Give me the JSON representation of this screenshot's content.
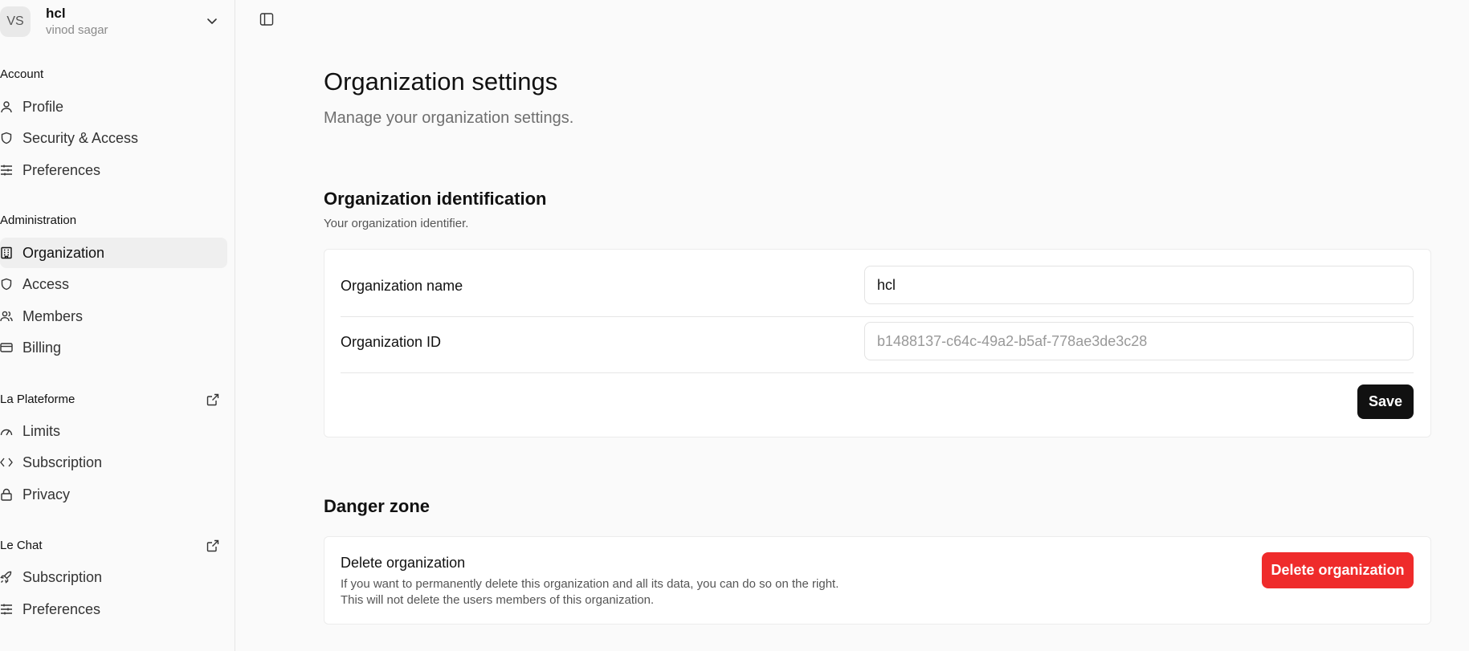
{
  "org_switcher": {
    "avatar_initials": "VS",
    "org_name": "hcl",
    "user_name": "vinod sagar"
  },
  "sidebar": {
    "sections": [
      {
        "label": "Account",
        "items": [
          {
            "label": "Profile",
            "icon": "user-icon"
          },
          {
            "label": "Security & Access",
            "icon": "shield-icon"
          },
          {
            "label": "Preferences",
            "icon": "sliders-icon"
          }
        ]
      },
      {
        "label": "Administration",
        "items": [
          {
            "label": "Organization",
            "icon": "building-icon",
            "active": true
          },
          {
            "label": "Access",
            "icon": "shield-icon"
          },
          {
            "label": "Members",
            "icon": "users-icon"
          },
          {
            "label": "Billing",
            "icon": "credit-card-icon"
          }
        ]
      },
      {
        "label": "La Plateforme",
        "external": true,
        "items": [
          {
            "label": "Limits",
            "icon": "gauge-icon"
          },
          {
            "label": "Subscription",
            "icon": "code-icon"
          },
          {
            "label": "Privacy",
            "icon": "lock-icon"
          }
        ]
      },
      {
        "label": "Le Chat",
        "external": true,
        "items": [
          {
            "label": "Subscription",
            "icon": "rocket-icon"
          },
          {
            "label": "Preferences",
            "icon": "sliders-icon"
          }
        ]
      }
    ]
  },
  "main": {
    "title": "Organization settings",
    "subtitle": "Manage your organization settings.",
    "identification": {
      "title": "Organization identification",
      "description": "Your organization identifier.",
      "name_label": "Organization name",
      "name_value": "hcl",
      "id_label": "Organization ID",
      "id_value": "b1488137-c64c-49a2-b5af-778ae3de3c28",
      "save_label": "Save"
    },
    "danger": {
      "title": "Danger zone",
      "item_title": "Delete organization",
      "item_desc_line1": "If you want to permanently delete this organization and all its data, you can do so on the right.",
      "item_desc_line2": "This will not delete the users members of this organization.",
      "delete_label": "Delete organization"
    }
  },
  "colors": {
    "danger": "#ef2b2b",
    "primary_button": "#111111",
    "active_nav": "#efefef"
  }
}
